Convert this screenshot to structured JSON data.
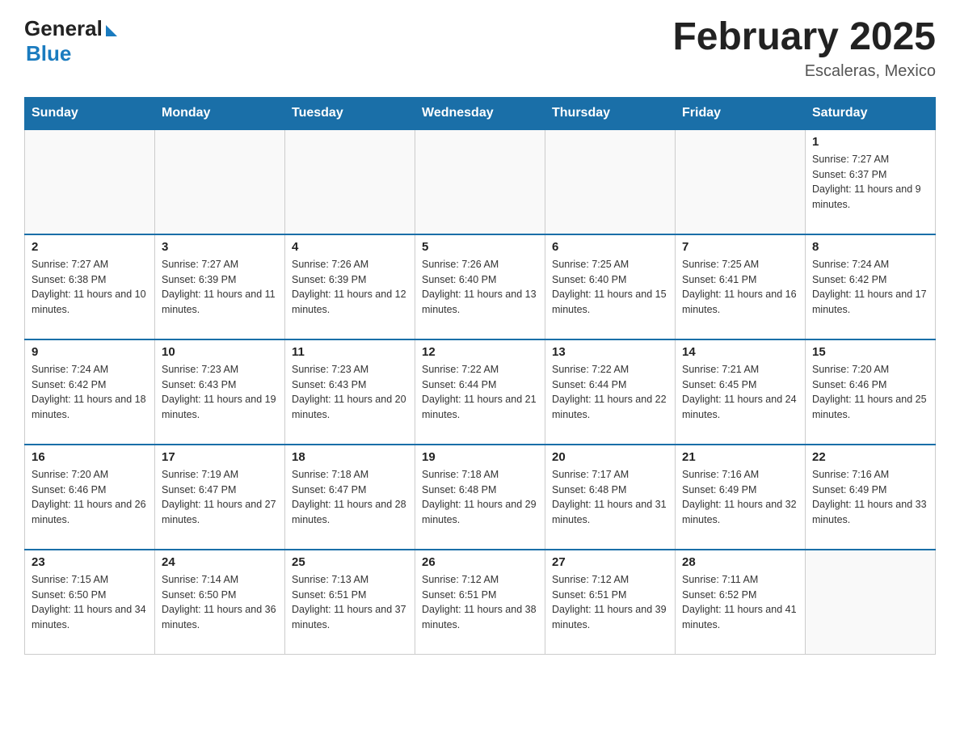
{
  "header": {
    "logo_general": "General",
    "logo_blue": "Blue",
    "month_title": "February 2025",
    "location": "Escaleras, Mexico"
  },
  "weekdays": [
    "Sunday",
    "Monday",
    "Tuesday",
    "Wednesday",
    "Thursday",
    "Friday",
    "Saturday"
  ],
  "weeks": [
    [
      {
        "day": "",
        "info": ""
      },
      {
        "day": "",
        "info": ""
      },
      {
        "day": "",
        "info": ""
      },
      {
        "day": "",
        "info": ""
      },
      {
        "day": "",
        "info": ""
      },
      {
        "day": "",
        "info": ""
      },
      {
        "day": "1",
        "info": "Sunrise: 7:27 AM\nSunset: 6:37 PM\nDaylight: 11 hours and 9 minutes."
      }
    ],
    [
      {
        "day": "2",
        "info": "Sunrise: 7:27 AM\nSunset: 6:38 PM\nDaylight: 11 hours and 10 minutes."
      },
      {
        "day": "3",
        "info": "Sunrise: 7:27 AM\nSunset: 6:39 PM\nDaylight: 11 hours and 11 minutes."
      },
      {
        "day": "4",
        "info": "Sunrise: 7:26 AM\nSunset: 6:39 PM\nDaylight: 11 hours and 12 minutes."
      },
      {
        "day": "5",
        "info": "Sunrise: 7:26 AM\nSunset: 6:40 PM\nDaylight: 11 hours and 13 minutes."
      },
      {
        "day": "6",
        "info": "Sunrise: 7:25 AM\nSunset: 6:40 PM\nDaylight: 11 hours and 15 minutes."
      },
      {
        "day": "7",
        "info": "Sunrise: 7:25 AM\nSunset: 6:41 PM\nDaylight: 11 hours and 16 minutes."
      },
      {
        "day": "8",
        "info": "Sunrise: 7:24 AM\nSunset: 6:42 PM\nDaylight: 11 hours and 17 minutes."
      }
    ],
    [
      {
        "day": "9",
        "info": "Sunrise: 7:24 AM\nSunset: 6:42 PM\nDaylight: 11 hours and 18 minutes."
      },
      {
        "day": "10",
        "info": "Sunrise: 7:23 AM\nSunset: 6:43 PM\nDaylight: 11 hours and 19 minutes."
      },
      {
        "day": "11",
        "info": "Sunrise: 7:23 AM\nSunset: 6:43 PM\nDaylight: 11 hours and 20 minutes."
      },
      {
        "day": "12",
        "info": "Sunrise: 7:22 AM\nSunset: 6:44 PM\nDaylight: 11 hours and 21 minutes."
      },
      {
        "day": "13",
        "info": "Sunrise: 7:22 AM\nSunset: 6:44 PM\nDaylight: 11 hours and 22 minutes."
      },
      {
        "day": "14",
        "info": "Sunrise: 7:21 AM\nSunset: 6:45 PM\nDaylight: 11 hours and 24 minutes."
      },
      {
        "day": "15",
        "info": "Sunrise: 7:20 AM\nSunset: 6:46 PM\nDaylight: 11 hours and 25 minutes."
      }
    ],
    [
      {
        "day": "16",
        "info": "Sunrise: 7:20 AM\nSunset: 6:46 PM\nDaylight: 11 hours and 26 minutes."
      },
      {
        "day": "17",
        "info": "Sunrise: 7:19 AM\nSunset: 6:47 PM\nDaylight: 11 hours and 27 minutes."
      },
      {
        "day": "18",
        "info": "Sunrise: 7:18 AM\nSunset: 6:47 PM\nDaylight: 11 hours and 28 minutes."
      },
      {
        "day": "19",
        "info": "Sunrise: 7:18 AM\nSunset: 6:48 PM\nDaylight: 11 hours and 29 minutes."
      },
      {
        "day": "20",
        "info": "Sunrise: 7:17 AM\nSunset: 6:48 PM\nDaylight: 11 hours and 31 minutes."
      },
      {
        "day": "21",
        "info": "Sunrise: 7:16 AM\nSunset: 6:49 PM\nDaylight: 11 hours and 32 minutes."
      },
      {
        "day": "22",
        "info": "Sunrise: 7:16 AM\nSunset: 6:49 PM\nDaylight: 11 hours and 33 minutes."
      }
    ],
    [
      {
        "day": "23",
        "info": "Sunrise: 7:15 AM\nSunset: 6:50 PM\nDaylight: 11 hours and 34 minutes."
      },
      {
        "day": "24",
        "info": "Sunrise: 7:14 AM\nSunset: 6:50 PM\nDaylight: 11 hours and 36 minutes."
      },
      {
        "day": "25",
        "info": "Sunrise: 7:13 AM\nSunset: 6:51 PM\nDaylight: 11 hours and 37 minutes."
      },
      {
        "day": "26",
        "info": "Sunrise: 7:12 AM\nSunset: 6:51 PM\nDaylight: 11 hours and 38 minutes."
      },
      {
        "day": "27",
        "info": "Sunrise: 7:12 AM\nSunset: 6:51 PM\nDaylight: 11 hours and 39 minutes."
      },
      {
        "day": "28",
        "info": "Sunrise: 7:11 AM\nSunset: 6:52 PM\nDaylight: 11 hours and 41 minutes."
      },
      {
        "day": "",
        "info": ""
      }
    ]
  ]
}
